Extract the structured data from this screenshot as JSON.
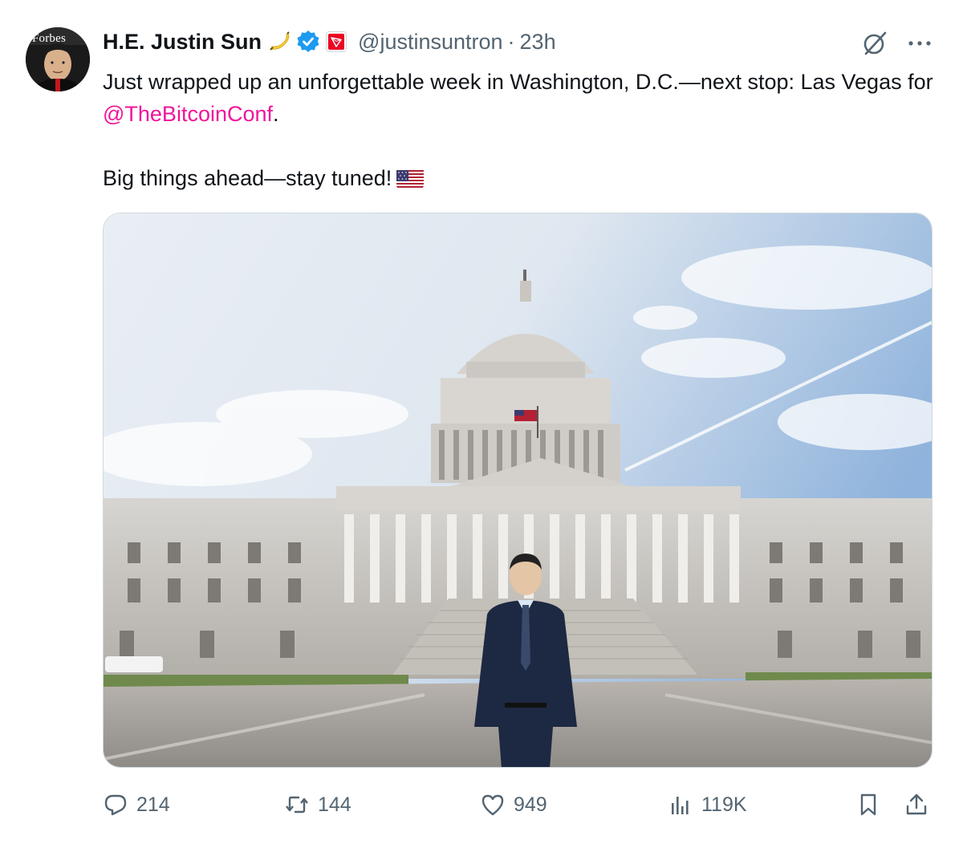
{
  "author": {
    "name": "H.E. Justin Sun",
    "handle": "@justinsuntron",
    "separator": "·",
    "time": "23h",
    "avatar_text": "Forbes"
  },
  "icons": {
    "name_emoji": "banana-emoji-icon",
    "verified": "verified-badge-icon",
    "affiliation": "tron-affiliation-badge-icon",
    "grok": "grok-icon",
    "more": "more-options-icon",
    "reply": "reply-icon",
    "retweet": "retweet-icon",
    "like": "heart-icon",
    "views": "views-icon",
    "bookmark": "bookmark-icon",
    "share": "share-icon",
    "flag": "us-flag-emoji-icon"
  },
  "tweet": {
    "line1_prefix": "Just wrapped up an unforgettable week in Washington, D.C.—next stop: Las Vegas for ",
    "mention": "@TheBitcoinConf",
    "line1_suffix": ".",
    "line2": "Big things ahead—stay tuned!"
  },
  "stats": {
    "replies": "214",
    "retweets": "144",
    "likes": "949",
    "views": "119K"
  },
  "colors": {
    "text": "#0f1419",
    "secondary": "#536471",
    "mention": "#f0149a",
    "verified": "#1d9bf0",
    "tron": "#ec0623"
  }
}
